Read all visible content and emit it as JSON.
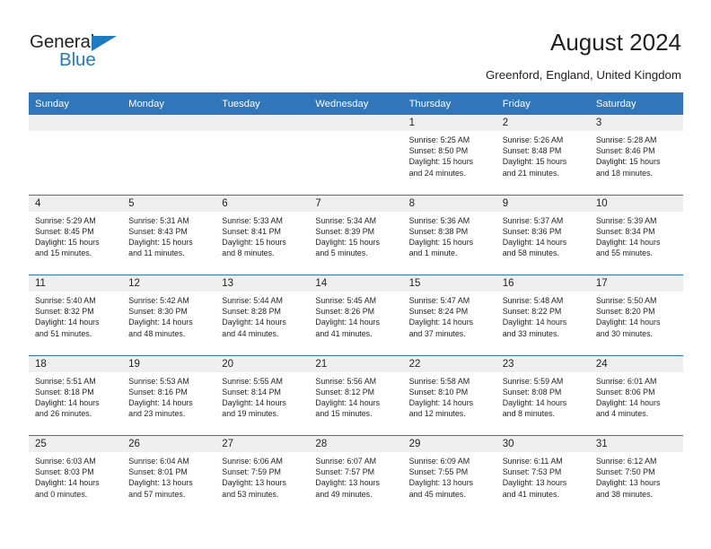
{
  "brand": {
    "name_top": "General",
    "name_bottom": "Blue",
    "triangle_icon": "brand-triangle-icon",
    "accent_color": "#1f7ac4"
  },
  "header": {
    "title": "August 2024",
    "location": "Greenford, England, United Kingdom"
  },
  "theme": {
    "header_blue": "#3176bb",
    "daynum_band": "#efefef",
    "text": "#231f20"
  },
  "weekday_headers": [
    "Sunday",
    "Monday",
    "Tuesday",
    "Wednesday",
    "Thursday",
    "Friday",
    "Saturday"
  ],
  "labels": {
    "sunrise_prefix": "Sunrise:",
    "sunset_prefix": "Sunset:",
    "daylight_prefix": "Daylight:"
  },
  "weeks": [
    [
      {
        "day": "",
        "empty": true
      },
      {
        "day": "",
        "empty": true
      },
      {
        "day": "",
        "empty": true
      },
      {
        "day": "",
        "empty": true
      },
      {
        "day": "1",
        "sunrise": "Sunrise: 5:25 AM",
        "sunset": "Sunset: 8:50 PM",
        "daylight_l1": "Daylight: 15 hours",
        "daylight_l2": "and 24 minutes."
      },
      {
        "day": "2",
        "sunrise": "Sunrise: 5:26 AM",
        "sunset": "Sunset: 8:48 PM",
        "daylight_l1": "Daylight: 15 hours",
        "daylight_l2": "and 21 minutes."
      },
      {
        "day": "3",
        "sunrise": "Sunrise: 5:28 AM",
        "sunset": "Sunset: 8:46 PM",
        "daylight_l1": "Daylight: 15 hours",
        "daylight_l2": "and 18 minutes."
      }
    ],
    [
      {
        "day": "4",
        "sunrise": "Sunrise: 5:29 AM",
        "sunset": "Sunset: 8:45 PM",
        "daylight_l1": "Daylight: 15 hours",
        "daylight_l2": "and 15 minutes."
      },
      {
        "day": "5",
        "sunrise": "Sunrise: 5:31 AM",
        "sunset": "Sunset: 8:43 PM",
        "daylight_l1": "Daylight: 15 hours",
        "daylight_l2": "and 11 minutes."
      },
      {
        "day": "6",
        "sunrise": "Sunrise: 5:33 AM",
        "sunset": "Sunset: 8:41 PM",
        "daylight_l1": "Daylight: 15 hours",
        "daylight_l2": "and 8 minutes."
      },
      {
        "day": "7",
        "sunrise": "Sunrise: 5:34 AM",
        "sunset": "Sunset: 8:39 PM",
        "daylight_l1": "Daylight: 15 hours",
        "daylight_l2": "and 5 minutes."
      },
      {
        "day": "8",
        "sunrise": "Sunrise: 5:36 AM",
        "sunset": "Sunset: 8:38 PM",
        "daylight_l1": "Daylight: 15 hours",
        "daylight_l2": "and 1 minute."
      },
      {
        "day": "9",
        "sunrise": "Sunrise: 5:37 AM",
        "sunset": "Sunset: 8:36 PM",
        "daylight_l1": "Daylight: 14 hours",
        "daylight_l2": "and 58 minutes."
      },
      {
        "day": "10",
        "sunrise": "Sunrise: 5:39 AM",
        "sunset": "Sunset: 8:34 PM",
        "daylight_l1": "Daylight: 14 hours",
        "daylight_l2": "and 55 minutes."
      }
    ],
    [
      {
        "day": "11",
        "sunrise": "Sunrise: 5:40 AM",
        "sunset": "Sunset: 8:32 PM",
        "daylight_l1": "Daylight: 14 hours",
        "daylight_l2": "and 51 minutes."
      },
      {
        "day": "12",
        "sunrise": "Sunrise: 5:42 AM",
        "sunset": "Sunset: 8:30 PM",
        "daylight_l1": "Daylight: 14 hours",
        "daylight_l2": "and 48 minutes."
      },
      {
        "day": "13",
        "sunrise": "Sunrise: 5:44 AM",
        "sunset": "Sunset: 8:28 PM",
        "daylight_l1": "Daylight: 14 hours",
        "daylight_l2": "and 44 minutes."
      },
      {
        "day": "14",
        "sunrise": "Sunrise: 5:45 AM",
        "sunset": "Sunset: 8:26 PM",
        "daylight_l1": "Daylight: 14 hours",
        "daylight_l2": "and 41 minutes."
      },
      {
        "day": "15",
        "sunrise": "Sunrise: 5:47 AM",
        "sunset": "Sunset: 8:24 PM",
        "daylight_l1": "Daylight: 14 hours",
        "daylight_l2": "and 37 minutes."
      },
      {
        "day": "16",
        "sunrise": "Sunrise: 5:48 AM",
        "sunset": "Sunset: 8:22 PM",
        "daylight_l1": "Daylight: 14 hours",
        "daylight_l2": "and 33 minutes."
      },
      {
        "day": "17",
        "sunrise": "Sunrise: 5:50 AM",
        "sunset": "Sunset: 8:20 PM",
        "daylight_l1": "Daylight: 14 hours",
        "daylight_l2": "and 30 minutes."
      }
    ],
    [
      {
        "day": "18",
        "sunrise": "Sunrise: 5:51 AM",
        "sunset": "Sunset: 8:18 PM",
        "daylight_l1": "Daylight: 14 hours",
        "daylight_l2": "and 26 minutes."
      },
      {
        "day": "19",
        "sunrise": "Sunrise: 5:53 AM",
        "sunset": "Sunset: 8:16 PM",
        "daylight_l1": "Daylight: 14 hours",
        "daylight_l2": "and 23 minutes."
      },
      {
        "day": "20",
        "sunrise": "Sunrise: 5:55 AM",
        "sunset": "Sunset: 8:14 PM",
        "daylight_l1": "Daylight: 14 hours",
        "daylight_l2": "and 19 minutes."
      },
      {
        "day": "21",
        "sunrise": "Sunrise: 5:56 AM",
        "sunset": "Sunset: 8:12 PM",
        "daylight_l1": "Daylight: 14 hours",
        "daylight_l2": "and 15 minutes."
      },
      {
        "day": "22",
        "sunrise": "Sunrise: 5:58 AM",
        "sunset": "Sunset: 8:10 PM",
        "daylight_l1": "Daylight: 14 hours",
        "daylight_l2": "and 12 minutes."
      },
      {
        "day": "23",
        "sunrise": "Sunrise: 5:59 AM",
        "sunset": "Sunset: 8:08 PM",
        "daylight_l1": "Daylight: 14 hours",
        "daylight_l2": "and 8 minutes."
      },
      {
        "day": "24",
        "sunrise": "Sunrise: 6:01 AM",
        "sunset": "Sunset: 8:06 PM",
        "daylight_l1": "Daylight: 14 hours",
        "daylight_l2": "and 4 minutes."
      }
    ],
    [
      {
        "day": "25",
        "sunrise": "Sunrise: 6:03 AM",
        "sunset": "Sunset: 8:03 PM",
        "daylight_l1": "Daylight: 14 hours",
        "daylight_l2": "and 0 minutes."
      },
      {
        "day": "26",
        "sunrise": "Sunrise: 6:04 AM",
        "sunset": "Sunset: 8:01 PM",
        "daylight_l1": "Daylight: 13 hours",
        "daylight_l2": "and 57 minutes."
      },
      {
        "day": "27",
        "sunrise": "Sunrise: 6:06 AM",
        "sunset": "Sunset: 7:59 PM",
        "daylight_l1": "Daylight: 13 hours",
        "daylight_l2": "and 53 minutes."
      },
      {
        "day": "28",
        "sunrise": "Sunrise: 6:07 AM",
        "sunset": "Sunset: 7:57 PM",
        "daylight_l1": "Daylight: 13 hours",
        "daylight_l2": "and 49 minutes."
      },
      {
        "day": "29",
        "sunrise": "Sunrise: 6:09 AM",
        "sunset": "Sunset: 7:55 PM",
        "daylight_l1": "Daylight: 13 hours",
        "daylight_l2": "and 45 minutes."
      },
      {
        "day": "30",
        "sunrise": "Sunrise: 6:11 AM",
        "sunset": "Sunset: 7:53 PM",
        "daylight_l1": "Daylight: 13 hours",
        "daylight_l2": "and 41 minutes."
      },
      {
        "day": "31",
        "sunrise": "Sunrise: 6:12 AM",
        "sunset": "Sunset: 7:50 PM",
        "daylight_l1": "Daylight: 13 hours",
        "daylight_l2": "and 38 minutes."
      }
    ]
  ]
}
